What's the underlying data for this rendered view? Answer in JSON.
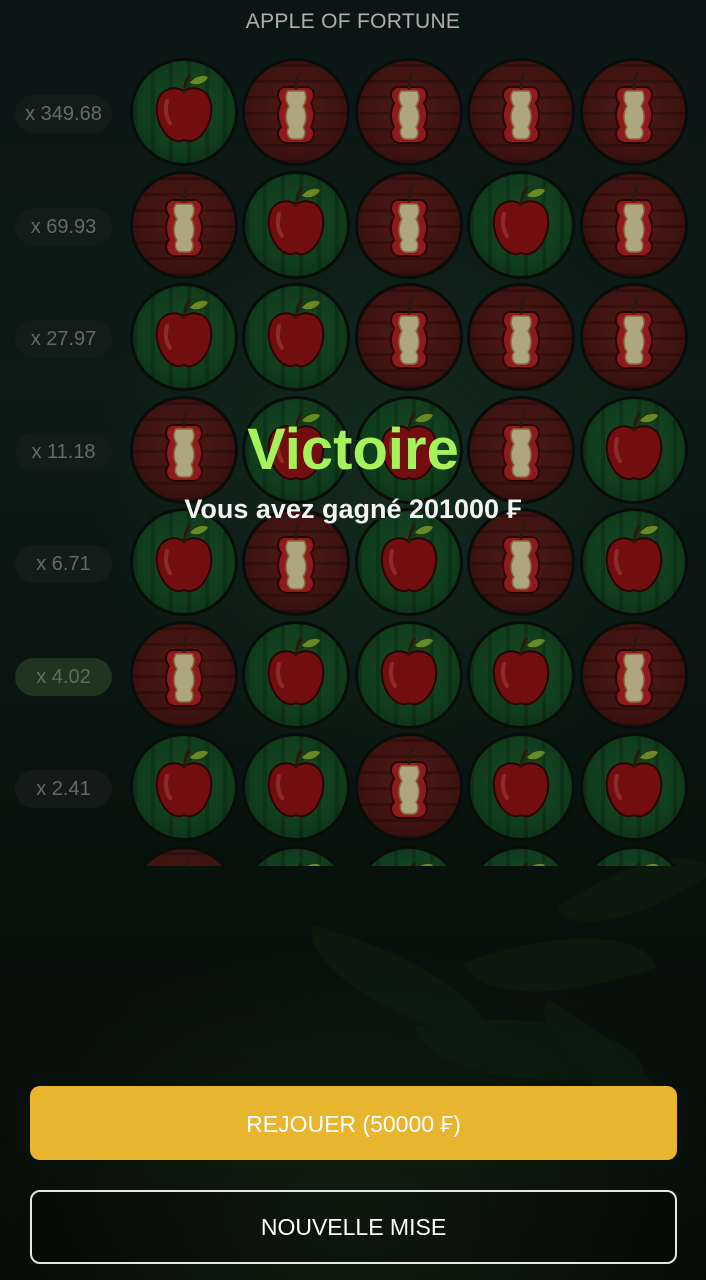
{
  "header": {
    "title": "APPLE OF FORTUNE"
  },
  "rows": [
    {
      "multiplier": "x 349.68",
      "active": false,
      "cells": [
        "apple",
        "core",
        "core",
        "core",
        "core"
      ]
    },
    {
      "multiplier": "x 69.93",
      "active": false,
      "cells": [
        "core",
        "apple",
        "core",
        "apple",
        "core"
      ]
    },
    {
      "multiplier": "x 27.97",
      "active": false,
      "cells": [
        "apple",
        "apple",
        "core",
        "core",
        "core"
      ]
    },
    {
      "multiplier": "x 11.18",
      "active": false,
      "cells": [
        "core",
        "apple",
        "apple",
        "core",
        "apple"
      ]
    },
    {
      "multiplier": "x 6.71",
      "active": false,
      "cells": [
        "apple",
        "core",
        "apple",
        "core",
        "apple"
      ]
    },
    {
      "multiplier": "x 4.02",
      "active": true,
      "cells": [
        "core",
        "apple",
        "apple",
        "apple",
        "core"
      ]
    },
    {
      "multiplier": "x 2.41",
      "active": false,
      "cells": [
        "apple",
        "apple",
        "core",
        "apple",
        "apple"
      ]
    },
    {
      "multiplier": "",
      "active": false,
      "cells": [
        "core",
        "apple",
        "apple",
        "apple",
        "apple"
      ]
    }
  ],
  "result": {
    "title": "Victoire",
    "message": "Vous avez gagné 201000 ₣"
  },
  "buttons": {
    "replay_label": "REJOUER (50000 ₣)",
    "new_bet_label": "NOUVELLE MISE"
  },
  "colors": {
    "win_green": "#a5f25a",
    "replay_button": "#e9b52f"
  },
  "icons": {
    "apple": "red-apple-icon",
    "core": "apple-core-icon"
  }
}
